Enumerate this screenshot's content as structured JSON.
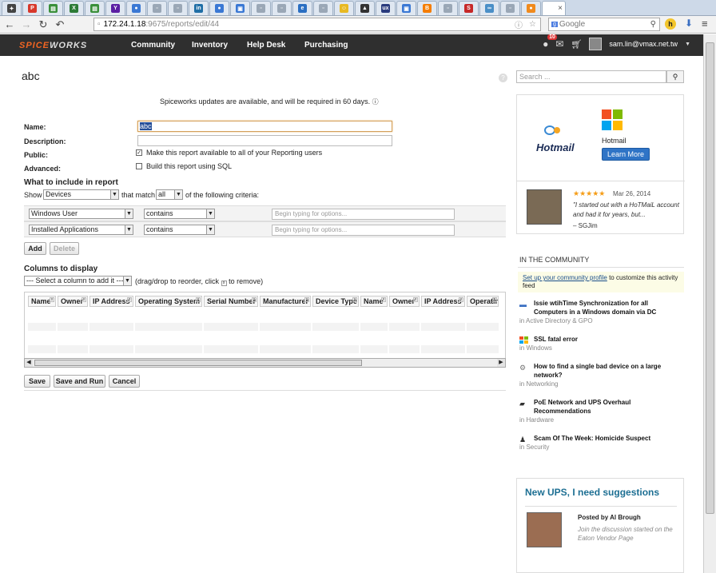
{
  "browser": {
    "tabs": [
      {
        "icon": "dog-icon",
        "color": "#444444",
        "glyph": "✦"
      },
      {
        "icon": "pdf-icon",
        "color": "#d7382b",
        "glyph": "P"
      },
      {
        "icon": "sheet-icon",
        "color": "#3a8f3a",
        "glyph": "▤"
      },
      {
        "icon": "excel-icon",
        "color": "#2d7b36",
        "glyph": "X"
      },
      {
        "icon": "sheet-icon",
        "color": "#3a8f3a",
        "glyph": "▤"
      },
      {
        "icon": "yahoo-icon",
        "color": "#5b1fa3",
        "glyph": "Y"
      },
      {
        "icon": "globe-icon",
        "color": "#3a78d4",
        "glyph": "●"
      },
      {
        "icon": "page-icon",
        "color": "#9aa7b6",
        "glyph": "▫"
      },
      {
        "icon": "page-icon",
        "color": "#9aa7b6",
        "glyph": "▫"
      },
      {
        "icon": "linkedin-icon",
        "color": "#1f6ea6",
        "glyph": "in"
      },
      {
        "icon": "globe-icon",
        "color": "#3a78d4",
        "glyph": "●"
      },
      {
        "icon": "image-icon",
        "color": "#3a78d4",
        "glyph": "▣"
      },
      {
        "icon": "page-icon",
        "color": "#9aa7b6",
        "glyph": "▫"
      },
      {
        "icon": "page-icon",
        "color": "#9aa7b6",
        "glyph": "▫"
      },
      {
        "icon": "ie-icon",
        "color": "#2b6fc2",
        "glyph": "e"
      },
      {
        "icon": "page-icon",
        "color": "#9aa7b6",
        "glyph": "▫"
      },
      {
        "icon": "smiley-icon",
        "color": "#e8b923",
        "glyph": "☺"
      },
      {
        "icon": "linux-icon",
        "color": "#333333",
        "glyph": "▲"
      },
      {
        "icon": "ux-icon",
        "color": "#2a3b7d",
        "glyph": "ux"
      },
      {
        "icon": "image-icon",
        "color": "#3a78d4",
        "glyph": "▣"
      },
      {
        "icon": "blogger-icon",
        "color": "#f57d00",
        "glyph": "B"
      },
      {
        "icon": "page-icon",
        "color": "#9aa7b6",
        "glyph": "▫"
      },
      {
        "icon": "s-icon",
        "color": "#c62828",
        "glyph": "S"
      },
      {
        "icon": "chain-icon",
        "color": "#4a8fc7",
        "glyph": "∞"
      },
      {
        "icon": "page-icon",
        "color": "#9aa7b6",
        "glyph": "▫"
      },
      {
        "icon": "orange-icon",
        "color": "#f08a1d",
        "glyph": "●"
      }
    ],
    "url_host": "172.24.1.18",
    "url_path": ":9675/reports/edit/44",
    "search_engine": "Google"
  },
  "nav": {
    "logo_main": "SPICE",
    "logo_rest": "WORKS",
    "links": [
      "Community",
      "Inventory",
      "Help Desk",
      "Purchasing"
    ],
    "notif_count": "10",
    "user": "sam.lin@vmax.net.tw"
  },
  "report": {
    "title": "abc",
    "notice": "Spiceworks updates are available, and will be required in 60 days.",
    "labels": {
      "name": "Name:",
      "description": "Description:",
      "public": "Public:",
      "advanced": "Advanced:"
    },
    "name_value": "abc",
    "public_text": "Make this report available to all of your Reporting users",
    "advanced_text": "Build this report using SQL",
    "include_heading": "What to include in report",
    "show_label": "Show",
    "show_value": "Devices",
    "match_label": "that match",
    "match_value": "all",
    "criteria_suffix": "of the following criteria:",
    "criteria": [
      {
        "field": "Windows User",
        "op": "contains",
        "placeholder": "Begin typing for options..."
      },
      {
        "field": "Installed Applications",
        "op": "contains",
        "placeholder": "Begin typing for options..."
      }
    ],
    "add_label": "Add",
    "delete_label": "Delete",
    "columns_heading": "Columns to display",
    "column_select": "--- Select a column to add it ---",
    "column_hint_a": "(drag/drop to reorder, click",
    "column_hint_b": "to remove)",
    "columns": [
      "Name",
      "Owner",
      "IP Address",
      "Operating System",
      "Serial Number",
      "Manufacturer",
      "Device Type",
      "Name",
      "Owner",
      "IP Address",
      "Operating"
    ],
    "save_label": "Save",
    "save_run_label": "Save and Run",
    "cancel_label": "Cancel"
  },
  "sidebar": {
    "search_placeholder": "Search ...",
    "ad_brand": "Hotmail",
    "ad_label": "Hotmail",
    "ad_button": "Learn More",
    "review_stars": "★★★★★",
    "review_date": "Mar 26, 2014",
    "review_text": "\"I started out with a HoTMaiL account and had it for years, but...",
    "review_author": "– SGJim",
    "community_heading": "IN THE COMMUNITY",
    "setup_link": "Set up your community profile",
    "setup_rest": "to customize this activity feed",
    "items": [
      {
        "title": "Issie wtihTime Synchronization for all Computers in a Windows domain via DC",
        "cat": "in Active Directory & GPO",
        "icon": "sync-icon"
      },
      {
        "title": "SSL fatal error",
        "cat": "in Windows",
        "icon": "windows-icon"
      },
      {
        "title": "How to find a single bad device on a large network?",
        "cat": "in Networking",
        "icon": "network-icon"
      },
      {
        "title": "PoE Network and UPS Overhaul Recommendations",
        "cat": "in Hardware",
        "icon": "hardware-icon"
      },
      {
        "title": "Scam Of The Week: Homicide Suspect",
        "cat": "in Security",
        "icon": "security-icon"
      }
    ],
    "ups_title": "New UPS, I need suggestions",
    "ups_posted": "Posted by Al Brough",
    "ups_join": "Join the discussion started on the Eaton Vendor Page"
  }
}
